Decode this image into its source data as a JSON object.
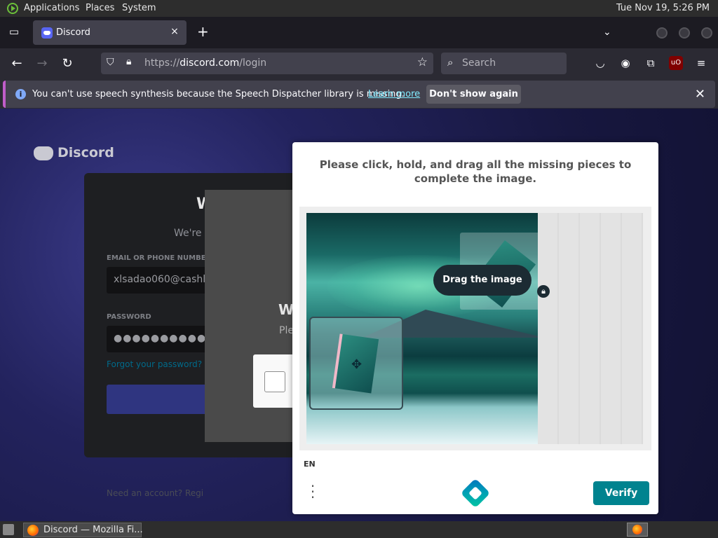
{
  "top_panel": {
    "menus": [
      "Applications",
      "Places",
      "System"
    ],
    "clock": "Tue Nov 19,  5:26 PM"
  },
  "browser": {
    "tab": {
      "title": "Discord",
      "close_icon": "×"
    },
    "new_tab_icon": "+",
    "url": {
      "scheme": "https://",
      "host": "discord.com",
      "path": "/login"
    },
    "search_placeholder": "Search",
    "notification": {
      "text": "You can't use speech synthesis because the Speech Dispatcher library is missing.",
      "link": "Learn more",
      "button": "Don't show again",
      "accent_color": "#c05dc9"
    }
  },
  "discord": {
    "logo_text": "Discord",
    "email_label": "EMAIL OR PHONE NUMBER",
    "email_value": "xlsadao060@cashl",
    "password_label": "PASSWORD",
    "password_value": "●●●●●●●●●●●●●●●●",
    "forgot": "Forgot your password?",
    "need_account": "Need an account? Regi",
    "heading_fragment": "W",
    "subtitle_fragment": "We're s",
    "modal_heading_fragment": "W",
    "modal_sub_fragment": "Ple"
  },
  "captcha": {
    "prompt": "Please click, hold, and drag all the missing pieces to complete the image.",
    "tooltip": "Drag the image",
    "language": "EN",
    "verify": "Verify",
    "accent_color": "#00838f"
  },
  "taskbar": {
    "window_title": "Discord — Mozilla Fi..."
  }
}
